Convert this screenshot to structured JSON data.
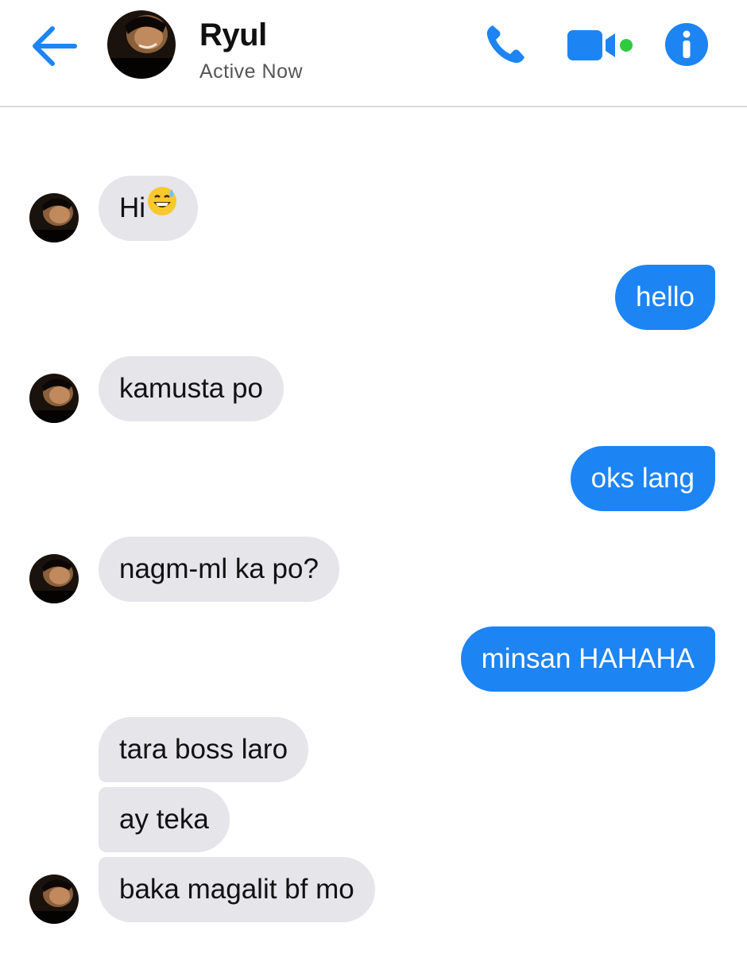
{
  "header": {
    "contact_name": "Ryul",
    "status": "Active Now",
    "icons": {
      "back": "arrow-left-icon",
      "call": "phone-icon",
      "video": "video-camera-icon",
      "info": "info-icon"
    },
    "colors": {
      "accent": "#1d84f4",
      "online_dot": "#2ecc40"
    }
  },
  "messages": [
    {
      "direction": "incoming",
      "text": "Hi",
      "emoji": "grinning-face-with-sweat"
    },
    {
      "direction": "outgoing",
      "text": "hello"
    },
    {
      "direction": "incoming",
      "text": "kamusta po"
    },
    {
      "direction": "outgoing",
      "text": "oks lang"
    },
    {
      "direction": "incoming",
      "text": "nagm-ml ka po?"
    },
    {
      "direction": "outgoing",
      "text": "minsan HAHAHA"
    },
    {
      "direction": "incoming",
      "text": "tara boss laro"
    },
    {
      "direction": "incoming",
      "text": "ay teka"
    },
    {
      "direction": "incoming",
      "text": "baka magalit bf mo"
    }
  ],
  "colors": {
    "incoming_bubble": "#e5e5ea",
    "outgoing_bubble": "#1d84f4"
  }
}
